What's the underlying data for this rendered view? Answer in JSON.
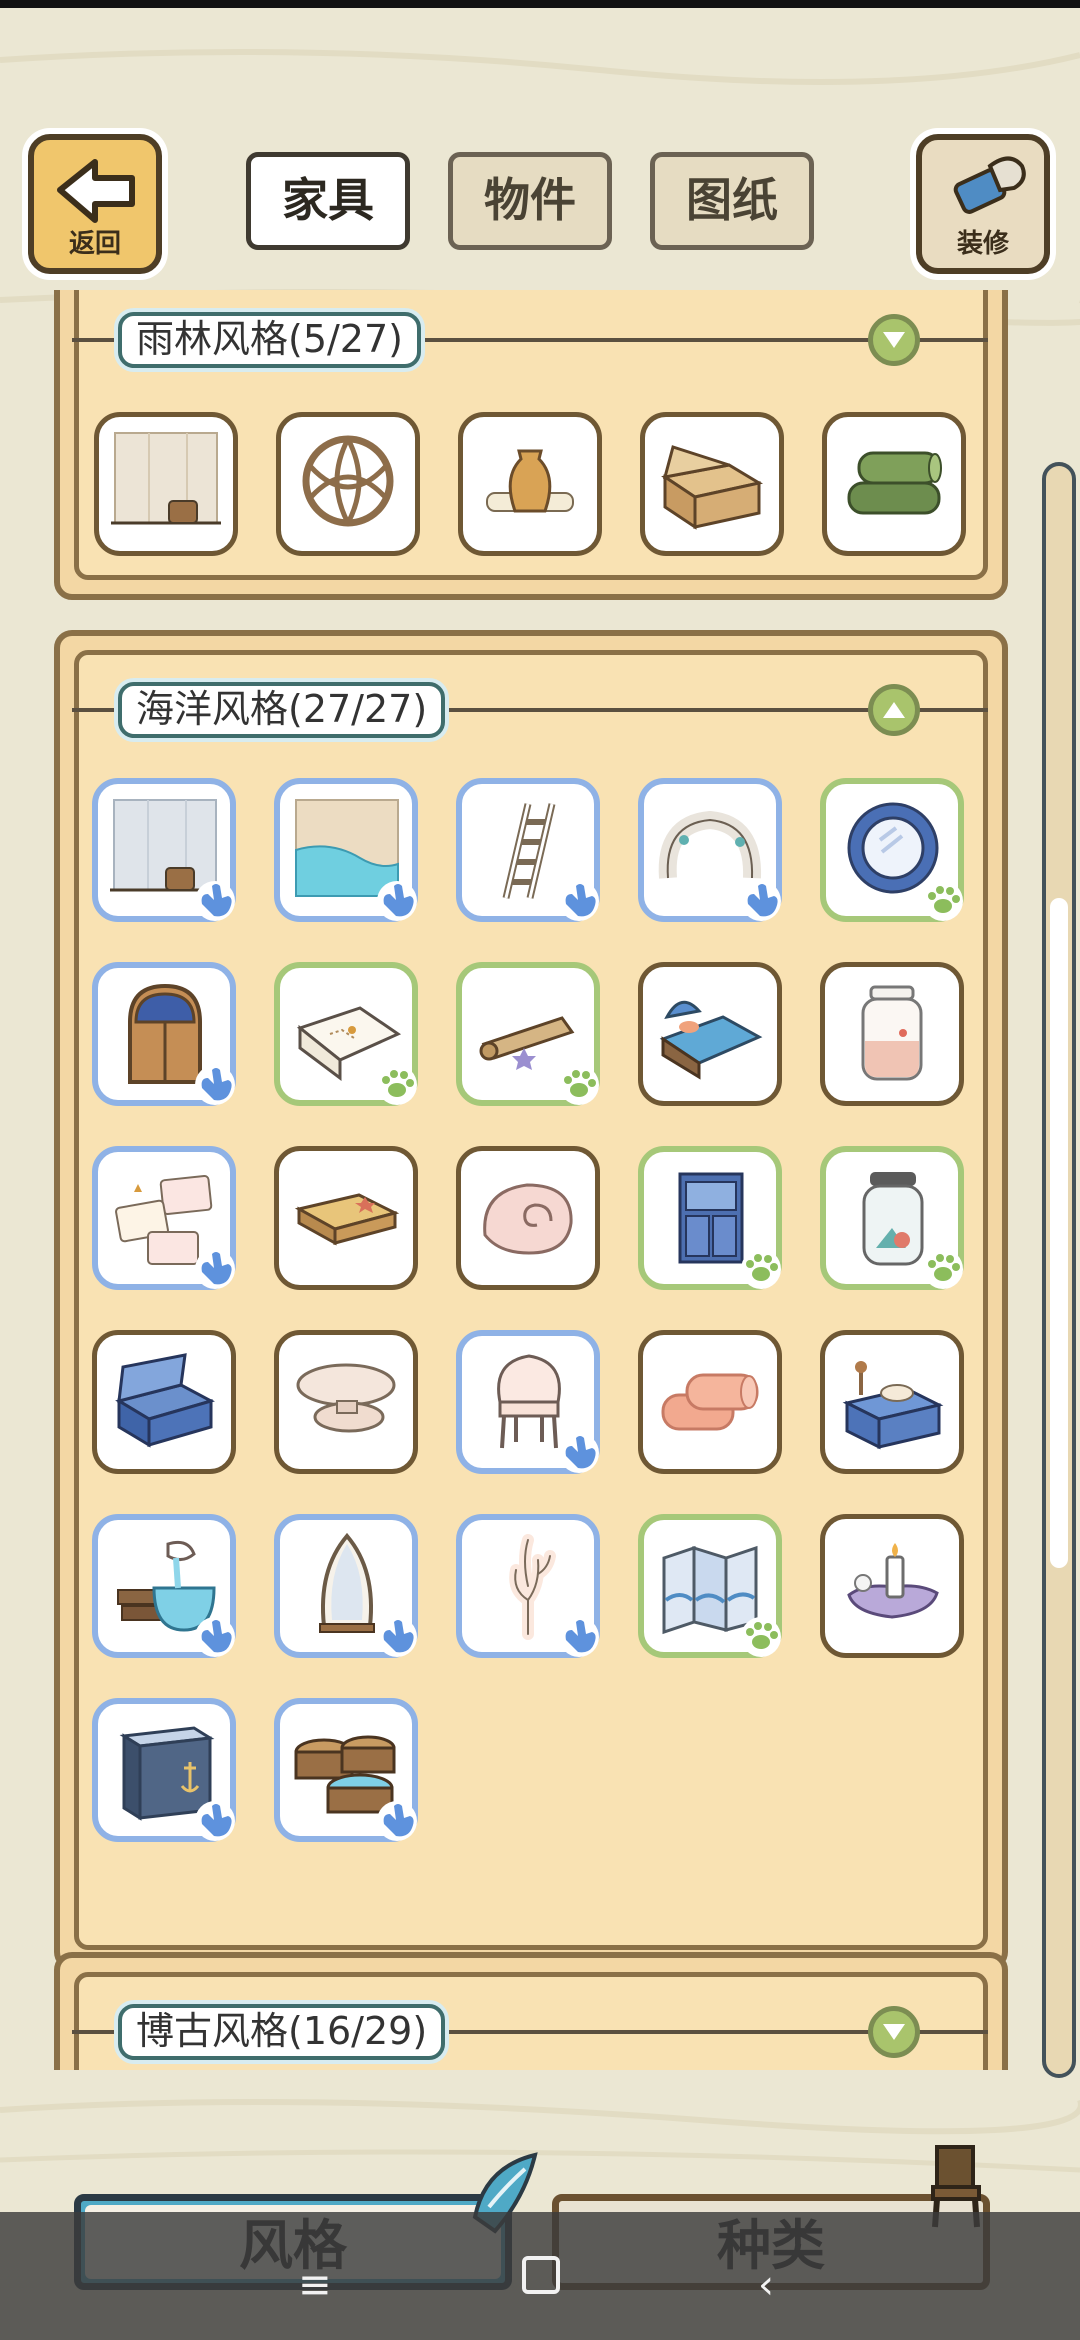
{
  "header": {
    "back_label": "返回",
    "decor_label": "装修",
    "tabs": [
      {
        "label": "家具",
        "active": true
      },
      {
        "label": "物件",
        "active": false
      },
      {
        "label": "图纸",
        "active": false
      }
    ]
  },
  "groups": {
    "rainforest": {
      "title": "雨林风格(5/27)",
      "expanded": false,
      "items": [
        {
          "icon": "wooden-wall-icon",
          "frame": "plain"
        },
        {
          "icon": "woven-ball-icon",
          "frame": "plain"
        },
        {
          "icon": "clay-jar-icon",
          "frame": "plain"
        },
        {
          "icon": "wooden-crate-icon",
          "frame": "plain"
        },
        {
          "icon": "mossy-logs-icon",
          "frame": "plain"
        }
      ]
    },
    "ocean": {
      "title": "海洋风格(27/27)",
      "expanded": true,
      "items": [
        {
          "icon": "wooden-wall-icon",
          "frame": "blue"
        },
        {
          "icon": "water-floor-icon",
          "frame": "blue"
        },
        {
          "icon": "ladder-icon",
          "frame": "blue"
        },
        {
          "icon": "stone-arch-icon",
          "frame": "blue"
        },
        {
          "icon": "porthole-mirror-icon",
          "frame": "green"
        },
        {
          "icon": "arched-door-icon",
          "frame": "blue"
        },
        {
          "icon": "treasure-map-icon",
          "frame": "green"
        },
        {
          "icon": "scroll-icon",
          "frame": "green"
        },
        {
          "icon": "shell-bed-icon",
          "frame": "plain"
        },
        {
          "icon": "sand-jar-icon",
          "frame": "plain"
        },
        {
          "icon": "postcards-icon",
          "frame": "blue"
        },
        {
          "icon": "low-table-icon",
          "frame": "plain"
        },
        {
          "icon": "nautilus-shell-icon",
          "frame": "plain"
        },
        {
          "icon": "blue-cabinet-icon",
          "frame": "green"
        },
        {
          "icon": "shell-jar-icon",
          "frame": "green"
        },
        {
          "icon": "blue-chest-icon",
          "frame": "plain"
        },
        {
          "icon": "shell-stand-icon",
          "frame": "plain"
        },
        {
          "icon": "shell-chair-icon",
          "frame": "blue"
        },
        {
          "icon": "rolled-towels-icon",
          "frame": "plain"
        },
        {
          "icon": "vanity-table-icon",
          "frame": "plain"
        },
        {
          "icon": "shell-fountain-icon",
          "frame": "blue"
        },
        {
          "icon": "surfboard-mirror-icon",
          "frame": "blue"
        },
        {
          "icon": "coral-icon",
          "frame": "blue"
        },
        {
          "icon": "folding-screen-icon",
          "frame": "green"
        },
        {
          "icon": "candle-shell-icon",
          "frame": "plain"
        },
        {
          "icon": "anchor-cabinet-icon",
          "frame": "blue"
        },
        {
          "icon": "barrel-tubs-icon",
          "frame": "blue"
        }
      ]
    },
    "antique": {
      "title": "博古风格(16/29)",
      "expanded": false
    }
  },
  "bottom_tabs": {
    "style_label": "风格",
    "kind_label": "种类"
  },
  "colors": {
    "blue_frame": "#8fb2e6",
    "green_frame": "#a6c879",
    "plain_frame": "#6f5834",
    "panel_bg": "#f9e2b3"
  }
}
